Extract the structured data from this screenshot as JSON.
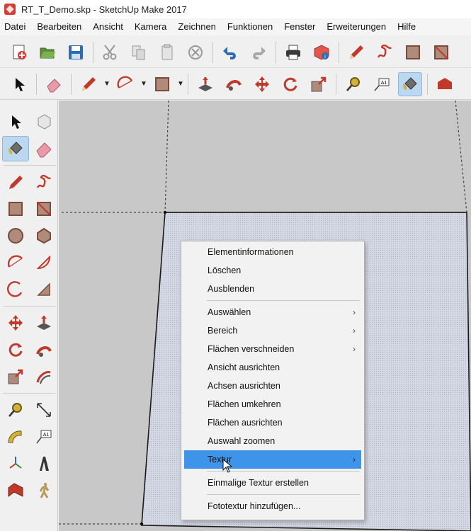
{
  "window": {
    "title": "RT_T_Demo.skp - SketchUp Make 2017"
  },
  "menubar": {
    "items": [
      "Datei",
      "Bearbeiten",
      "Ansicht",
      "Kamera",
      "Zeichnen",
      "Funktionen",
      "Fenster",
      "Erweiterungen",
      "Hilfe"
    ]
  },
  "toolbar_standard": {
    "buttons": [
      "new-icon",
      "open-icon",
      "save-icon",
      "cut-icon",
      "copy-icon",
      "paste-icon",
      "erase-icon",
      "undo-icon",
      "redo-icon",
      "print-icon",
      "model-info-icon",
      "pencil-icon",
      "freehand-icon",
      "rectangle-icon",
      "rotated-rectangle-icon"
    ]
  },
  "toolbar_getting_started": {
    "buttons": [
      "select-icon",
      "eraser-icon",
      "line-icon",
      "arc-icon",
      "shapes-icon",
      "push-pull-icon",
      "follow-me-icon",
      "move-icon",
      "rotate-icon",
      "scale-icon",
      "tape-measure-icon",
      "text-icon",
      "paint-bucket-icon",
      "warehouse-icon"
    ]
  },
  "sidebar": {
    "tools": [
      "select-icon",
      "component-icon",
      "paint-bucket-icon",
      "eraser-icon",
      "line-icon",
      "freehand-icon",
      "rectangle-icon",
      "rotated-rectangle-icon",
      "circle-icon",
      "polygon-icon",
      "arc-icon",
      "pie-icon",
      "three-point-arc-icon",
      "two-point-arc-icon",
      "move-icon",
      "push-pull-icon",
      "rotate-icon",
      "follow-me-icon",
      "scale-icon",
      "offset-icon",
      "tape-measure-icon",
      "dimension-icon",
      "protractor-icon",
      "text-icon",
      "axes-icon",
      "3d-text-icon",
      "section-plane-icon",
      "walk-icon"
    ]
  },
  "context_menu": {
    "group1": [
      "Elementinformationen",
      "Löschen",
      "Ausblenden"
    ],
    "group2": [
      {
        "label": "Auswählen",
        "submenu": true
      },
      {
        "label": "Bereich",
        "submenu": true
      },
      {
        "label": "Flächen verschneiden",
        "submenu": true
      },
      {
        "label": "Ansicht ausrichten",
        "submenu": false
      },
      {
        "label": "Achsen ausrichten",
        "submenu": false
      },
      {
        "label": "Flächen umkehren",
        "submenu": false
      },
      {
        "label": "Flächen ausrichten",
        "submenu": false
      },
      {
        "label": "Auswahl zoomen",
        "submenu": false
      }
    ],
    "highlighted": {
      "label": "Textur",
      "submenu": true
    },
    "group3": [
      "Einmalige Textur erstellen"
    ],
    "group4": [
      "Fototextur hinzufügen..."
    ],
    "submenu_arrow": "›"
  },
  "colors": {
    "highlight": "#3e94e8",
    "viewport_bg": "#c8c8c8",
    "face_fill": "#d4d8e4",
    "accent_red": "#d83a34"
  }
}
